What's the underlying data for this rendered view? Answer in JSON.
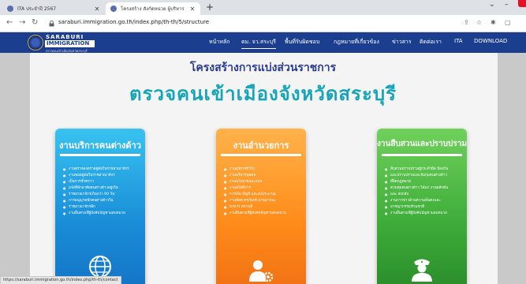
{
  "browser": {
    "tabs": [
      {
        "title": "ITA ประจำปี 2567",
        "active": false
      },
      {
        "title": "โครงสร้าง สังกัดหน่วย ผู้บริหาร",
        "active": true
      }
    ],
    "new_tab_symbol": "+",
    "url": "saraburi.immigration.go.th/index.php/th-th/5/structure",
    "icons": [
      "back-icon",
      "forward-icon",
      "reload-icon",
      "lock-icon",
      "share-icon",
      "star-icon",
      "extensions-icon",
      "sidepanel-icon"
    ]
  },
  "site": {
    "logo": {
      "line1": "SARABURI",
      "line2": "IMMIGRATION",
      "line3": "ตรวจคนเข้าเมืองจังหวัดสระบุรี"
    },
    "nav": [
      {
        "label": "หน้าหลัก",
        "active": false
      },
      {
        "label": "ตม. จว.สระบุรี",
        "active": true
      },
      {
        "label": "พื้นที่รับผิดชอบ",
        "active": false
      },
      {
        "label": "กฎหมายที่เกี่ยวข้อง",
        "active": false
      },
      {
        "label": "ข่าวสาร",
        "active": false
      },
      {
        "label": "ติดต่อเรา",
        "active": false
      },
      {
        "label": "ITA",
        "active": false
      },
      {
        "label": "DOWNLOAD",
        "active": false
      }
    ]
  },
  "page": {
    "heading": "โครงสร้างการแบ่งส่วนราชการ",
    "subheading": "ตรวจคนเข้าเมืองจังหวัดสระบุรี",
    "cards": [
      {
        "title": "งานบริการคนต่างด้าว",
        "color": "#1a8ed8",
        "icon": "globe-people-icon",
        "items": [
          "งานตรวจลงตราอยู่ต่อในราชอาณาจักร",
          "งานขออยู่ต่อในราชอาณาจักร",
          "เป็นการชั่วคราว",
          "แจ้งที่พักอาศัยคนต่างด้าวอยู่เกิน",
          "ราชอาณาจักรเกินกว่า 90 วัน",
          "การอนุญาตพักคนต่างด้าวใน",
          "ราชอาณาจักรอีก",
          "งานอื่นตามที่ผู้บังคับบัญชามอบหมาย"
        ]
      },
      {
        "title": "งานอำนวยการ",
        "color": "#ff8c1a",
        "icon": "person-gear-icon",
        "items": [
          "งานธุรการทั่วไป",
          "งานบริหารบุคคล",
          "งานนโยบายและแผน",
          "งานสวัสดิการ",
          "การเงิน บัญชี และงบประมาณ",
          "งานพัสดุ ครุภัณฑ์ ยานพาหนะ",
          "อาคาร สถานที่",
          "งานอื่นตามที่ผู้บังคับบัญชามอบหมาย"
        ]
      },
      {
        "title": "งานสืบสวนและปราบปราม",
        "color": "#3fad3a",
        "icon": "police-officer-icon",
        "items": [
          "สืบสวนปราบปรามผู้กระทำผิด ป้องกัน",
          "และปราบปรามและจับกุมคนต่างด้าว",
          "ที่ผิดกฎหมาย",
          "ควบคุมคนต่างด้าว ได้แก่ งานผลักดัน",
          "และ ส่งกลับ",
          "งานการข่าวด้านความมั่นคงและ",
          "อาชญากรรมข้ามชาติ",
          "งานอื่นตามที่ผู้บังคับบัญชามอบหมาย"
        ]
      }
    ]
  },
  "statusbar": {
    "text": "https://saraburi.immigration.go.th/index.php/th-th/contact"
  }
}
